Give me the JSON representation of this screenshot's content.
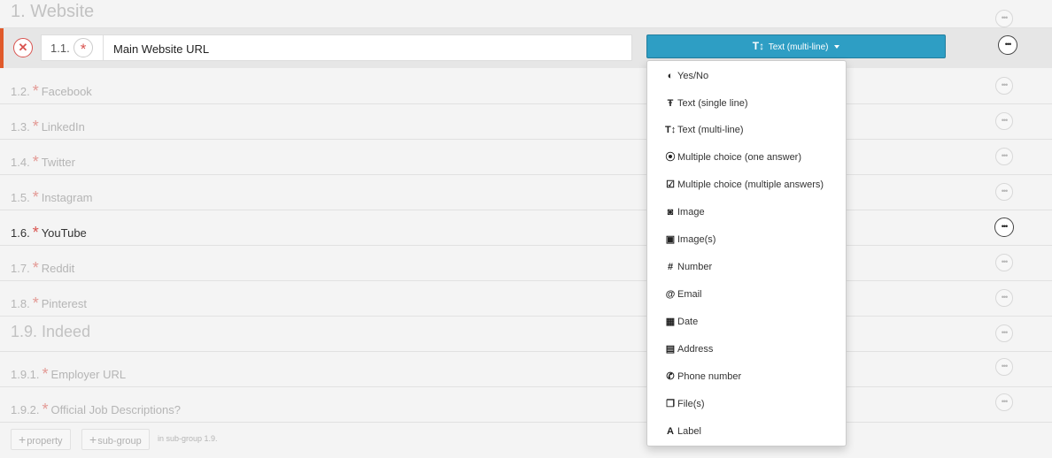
{
  "group": {
    "title": "1. Website"
  },
  "active": {
    "index": "1.1.",
    "required_mark": "*",
    "name": "Main Website URL",
    "type_icon": "T↕",
    "type_label": "Text (multi-line)"
  },
  "properties": [
    {
      "index": "1.2.",
      "star": "*",
      "name": "Facebook"
    },
    {
      "index": "1.3.",
      "star": "*",
      "name": "LinkedIn"
    },
    {
      "index": "1.4.",
      "star": "*",
      "name": "Twitter"
    },
    {
      "index": "1.5.",
      "star": "*",
      "name": "Instagram"
    },
    {
      "index": "1.6.",
      "star": "*",
      "name": "YouTube"
    },
    {
      "index": "1.7.",
      "star": "*",
      "name": "Reddit"
    },
    {
      "index": "1.8.",
      "star": "*",
      "name": "Pinterest"
    }
  ],
  "subgroup": {
    "title": "1.9. Indeed",
    "items": [
      {
        "index": "1.9.1.",
        "star": "*",
        "name": "Employer URL"
      },
      {
        "index": "1.9.2.",
        "star": "*",
        "name": "Official Job Descriptions?"
      }
    ]
  },
  "dropdown": {
    "items": [
      {
        "icon": "toggle-icon",
        "glyph": "◐",
        "label": "Yes/No"
      },
      {
        "icon": "text-single-icon",
        "glyph": "Ŧ",
        "label": "Text (single line)"
      },
      {
        "icon": "text-multi-icon",
        "glyph": "T↕",
        "label": "Text (multi-line)"
      },
      {
        "icon": "radio-icon",
        "glyph": "⦿",
        "label": "Multiple choice (one answer)"
      },
      {
        "icon": "checkbox-icon",
        "glyph": "☑",
        "label": "Multiple choice (multiple answers)"
      },
      {
        "icon": "camera-icon",
        "glyph": "◙",
        "label": "Image"
      },
      {
        "icon": "images-icon",
        "glyph": "▣",
        "label": "Image(s)"
      },
      {
        "icon": "hash-icon",
        "glyph": "#",
        "label": "Number"
      },
      {
        "icon": "at-icon",
        "glyph": "@",
        "label": "Email"
      },
      {
        "icon": "calendar-icon",
        "glyph": "▦",
        "label": "Date"
      },
      {
        "icon": "address-card-icon",
        "glyph": "▤",
        "label": "Address"
      },
      {
        "icon": "phone-icon",
        "glyph": "✆",
        "label": "Phone number"
      },
      {
        "icon": "files-icon",
        "glyph": "❐",
        "label": "File(s)"
      },
      {
        "icon": "label-icon",
        "glyph": "A",
        "label": "Label"
      }
    ]
  },
  "footer": {
    "add_property": "property",
    "add_subgroup": "sub-group",
    "hint": "in sub-group 1.9."
  },
  "colors": {
    "accent": "#2e9ec4",
    "active_border": "#e05a2b",
    "required": "#d9534f"
  }
}
